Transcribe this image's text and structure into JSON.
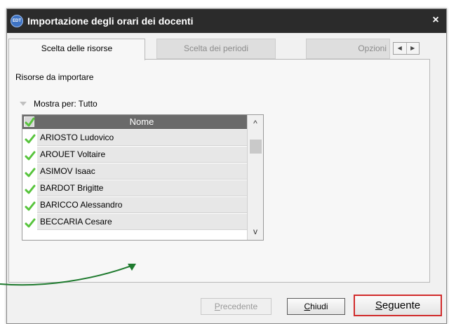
{
  "window": {
    "icon_text": "EDT",
    "title": "Importazione degli orari dei docenti",
    "close_glyph": "×"
  },
  "tabs": [
    {
      "label": "Scelta delle risorse",
      "active": true
    },
    {
      "label": "Scelta dei periodi",
      "active": false
    },
    {
      "label": "Opzioni",
      "active": false
    }
  ],
  "tab_scroll": {
    "left_glyph": "◀",
    "right_glyph": "▶"
  },
  "panel": {
    "section_label": "Risorse da importare",
    "filter_label": "Mostra per: Tutto",
    "column_header": "Nome",
    "rows": [
      {
        "name": "ARIOSTO Ludovico",
        "checked": true
      },
      {
        "name": "AROUET Voltaire",
        "checked": true
      },
      {
        "name": "ASIMOV Isaac",
        "checked": true
      },
      {
        "name": "BARDOT Brigitte",
        "checked": true
      },
      {
        "name": "BARICCO Alessandro",
        "checked": true
      },
      {
        "name": "BECCARIA Cesare",
        "checked": true
      }
    ],
    "scroll_up_glyph": "^",
    "scroll_down_glyph": "v"
  },
  "buttons": {
    "previous": {
      "mnemonic": "P",
      "rest": "recedente",
      "enabled": false
    },
    "close": {
      "mnemonic": "C",
      "rest": "hiudi",
      "enabled": true
    },
    "next": {
      "mnemonic": "S",
      "rest": "eguente",
      "enabled": true,
      "highlight_color": "#d12b2b"
    }
  },
  "colors": {
    "titlebar": "#2b2b2b",
    "check_green": "#57c43c",
    "annotation_arrow": "#1e7a2e",
    "header_bg": "#6a6a6a"
  }
}
